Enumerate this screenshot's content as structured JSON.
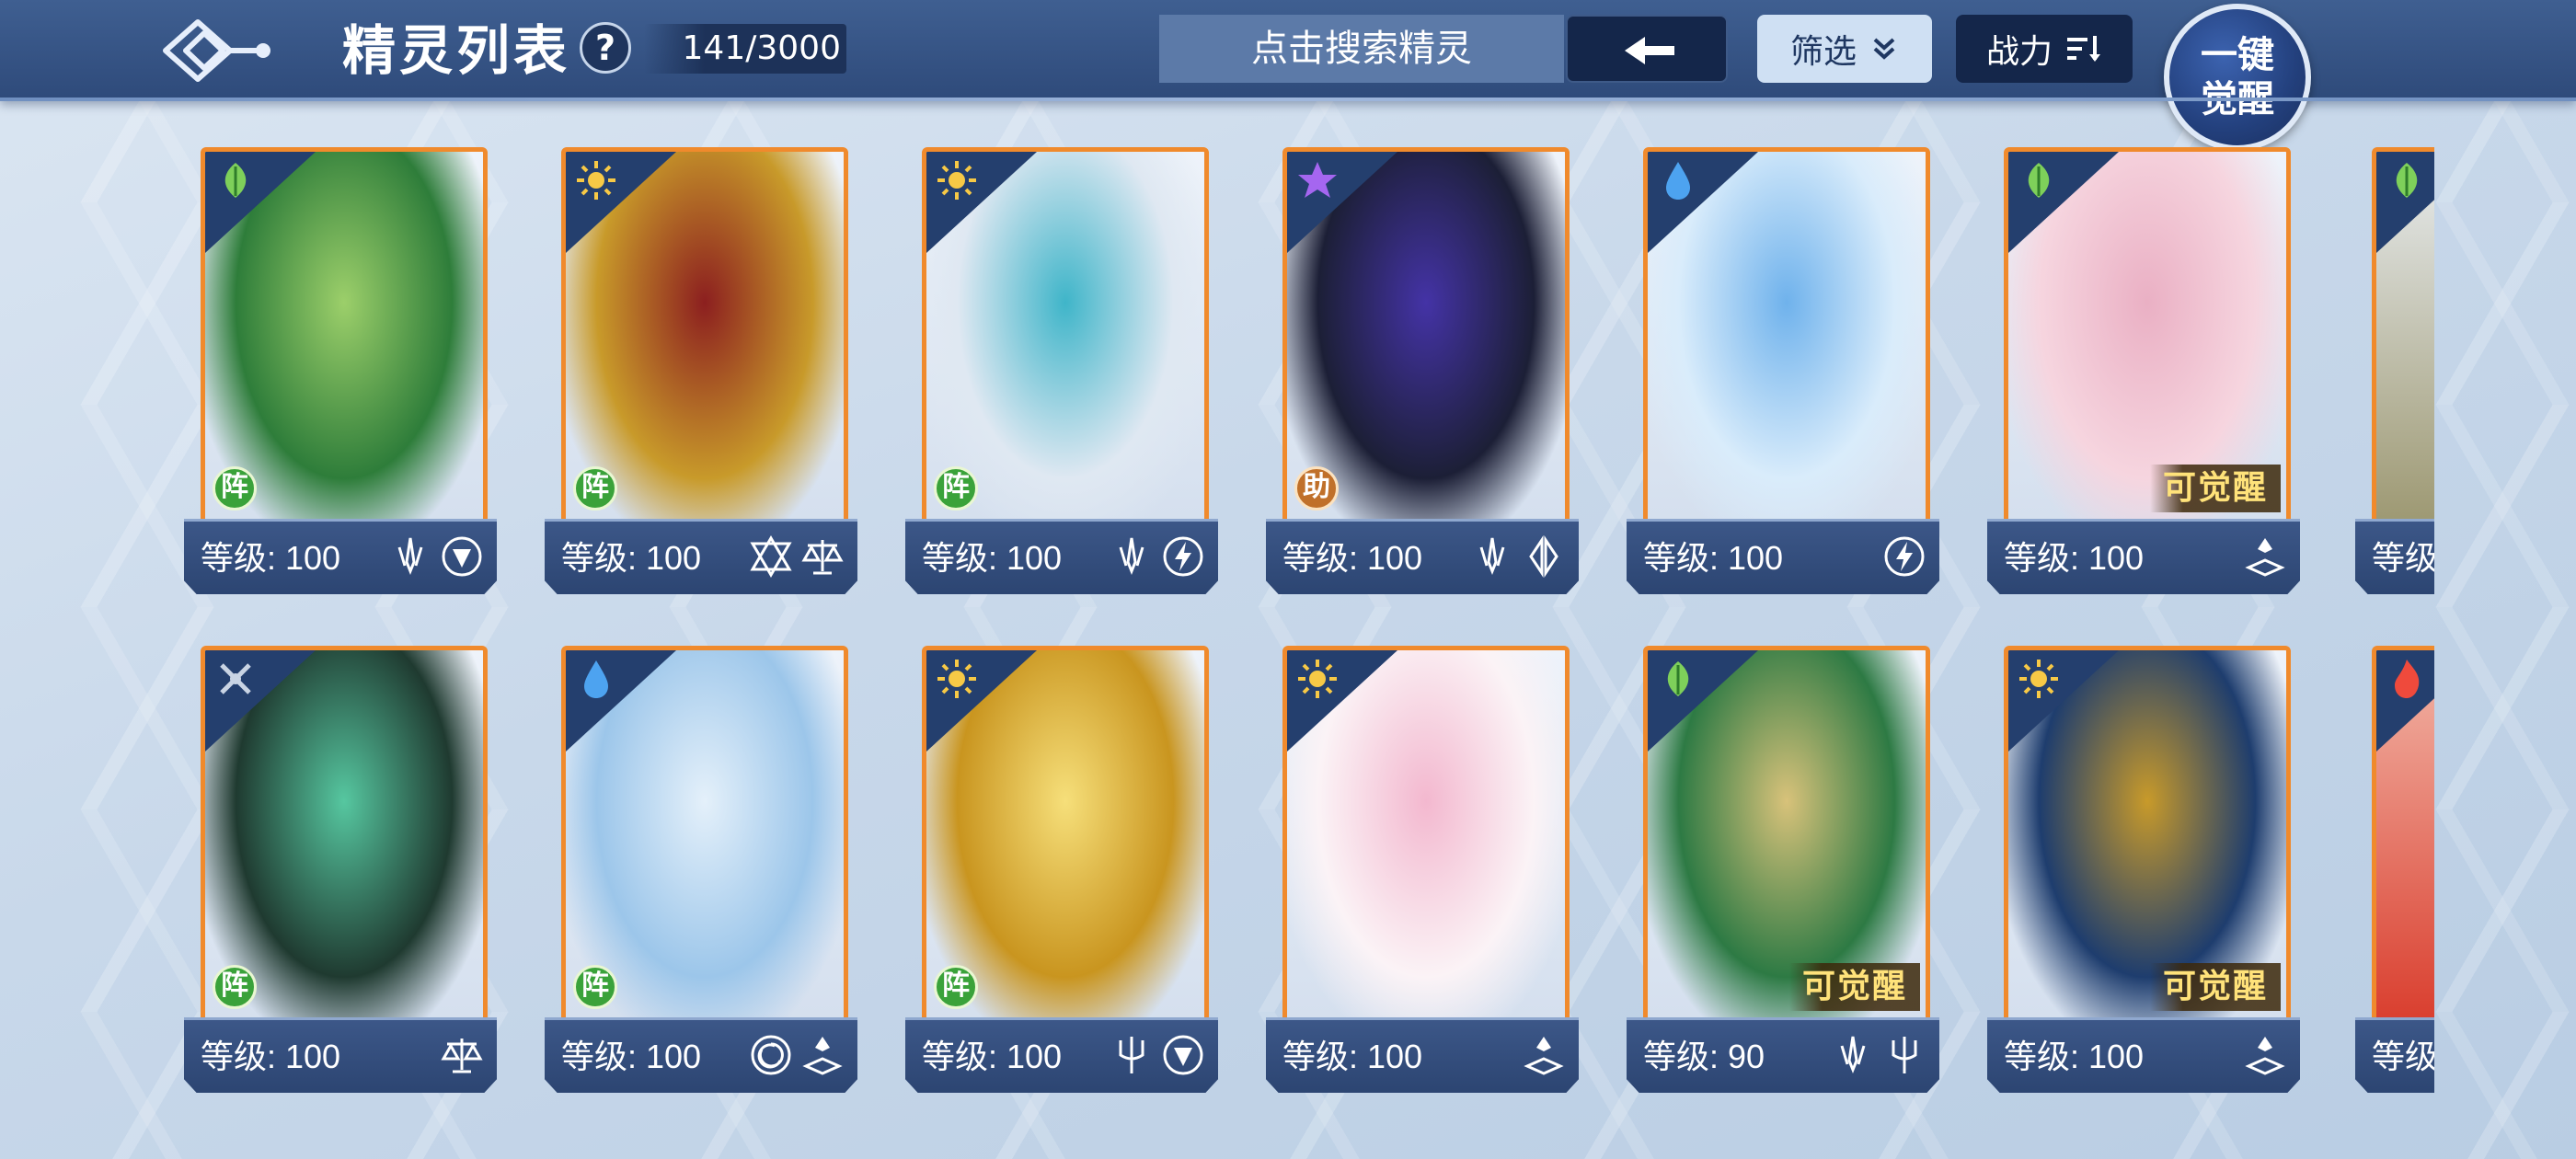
{
  "header": {
    "title": "精灵列表",
    "help_label": "?",
    "count": "141/3000",
    "search_placeholder": "点击搜索精灵",
    "filter_label": "筛选",
    "sort_label": "战力",
    "awaken_label_line1": "一键",
    "awaken_label_line2": "觉醒"
  },
  "colors": {
    "frame_orange": "#f08a2c",
    "footer_navy": "#2c4572",
    "badge_green": "#3aa23a",
    "badge_brown": "#c0702a",
    "awaken_gold": "#ffe27a"
  },
  "level_prefix": "等级:",
  "cards": [
    {
      "element": "leaf",
      "badge": "阵",
      "level": "100",
      "awaken": "",
      "attrs": [
        "sword-icon",
        "shield-icon"
      ],
      "tint": [
        "#2e7d3a",
        "#9ccf6a"
      ]
    },
    {
      "element": "sun",
      "badge": "阵",
      "level": "100",
      "awaken": "",
      "attrs": [
        "hexagram-icon",
        "scales-icon"
      ],
      "tint": [
        "#c89a2a",
        "#8c1f1f"
      ]
    },
    {
      "element": "sun",
      "badge": "阵",
      "level": "100",
      "awaken": "",
      "attrs": [
        "sword-icon",
        "lightning-icon"
      ],
      "tint": [
        "#dfe8f2",
        "#3fb5c9"
      ]
    },
    {
      "element": "star",
      "badge": "助",
      "level": "100",
      "awaken": "",
      "attrs": [
        "sword-icon",
        "wings-icon"
      ],
      "tint": [
        "#1c1f36",
        "#4433a6"
      ]
    },
    {
      "element": "water",
      "badge": "",
      "level": "100",
      "awaken": "",
      "attrs": [
        "lightning-icon"
      ],
      "tint": [
        "#d9ecfb",
        "#6fb2ec"
      ]
    },
    {
      "element": "leaf",
      "badge": "",
      "level": "100",
      "awaken": "可觉醒",
      "attrs": [
        "book-icon"
      ],
      "tint": [
        "#f6d5df",
        "#eab0c4"
      ]
    },
    {
      "element": "cross",
      "badge": "阵",
      "level": "100",
      "awaken": "",
      "attrs": [
        "scales-icon"
      ],
      "tint": [
        "#1f3a30",
        "#56c7a0"
      ]
    },
    {
      "element": "water",
      "badge": "阵",
      "level": "100",
      "awaken": "",
      "attrs": [
        "spiral-icon",
        "book-icon"
      ],
      "tint": [
        "#9cc6ea",
        "#e4f0fa"
      ]
    },
    {
      "element": "sun",
      "badge": "阵",
      "level": "100",
      "awaken": "",
      "attrs": [
        "trident-icon",
        "shield-icon"
      ],
      "tint": [
        "#c9951f",
        "#f6df7a"
      ]
    },
    {
      "element": "sun",
      "badge": "",
      "level": "100",
      "awaken": "",
      "attrs": [
        "book-icon"
      ],
      "tint": [
        "#fbf3f6",
        "#f3b8cf"
      ]
    },
    {
      "element": "leaf",
      "badge": "",
      "level": "90",
      "awaken": "可觉醒",
      "attrs": [
        "sword-icon",
        "trident-icon"
      ],
      "tint": [
        "#2d7a44",
        "#d8c27a"
      ]
    },
    {
      "element": "sun",
      "badge": "",
      "level": "100",
      "awaken": "可觉醒",
      "attrs": [
        "book-icon"
      ],
      "tint": [
        "#1e3d6e",
        "#c89a2a"
      ]
    }
  ],
  "clipped_cards": [
    {
      "element": "leaf",
      "level_prefix": "等级"
    },
    {
      "element": "fire",
      "level_prefix": "等级"
    }
  ]
}
